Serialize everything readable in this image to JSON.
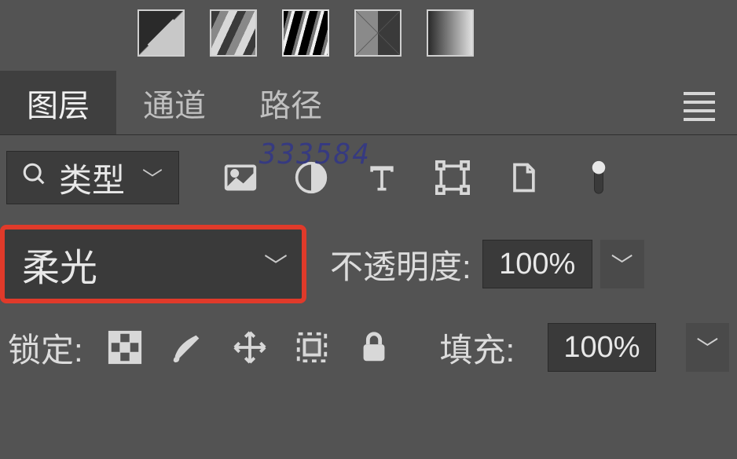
{
  "watermark": "333584",
  "tabs": {
    "layers": "图层",
    "channels": "通道",
    "paths": "路径"
  },
  "filter": {
    "kind_label": "类型"
  },
  "blend": {
    "mode": "柔光",
    "opacity_label": "不透明度:",
    "opacity_value": "100%"
  },
  "lock": {
    "label": "锁定:",
    "fill_label": "填充:",
    "fill_value": "100%"
  }
}
